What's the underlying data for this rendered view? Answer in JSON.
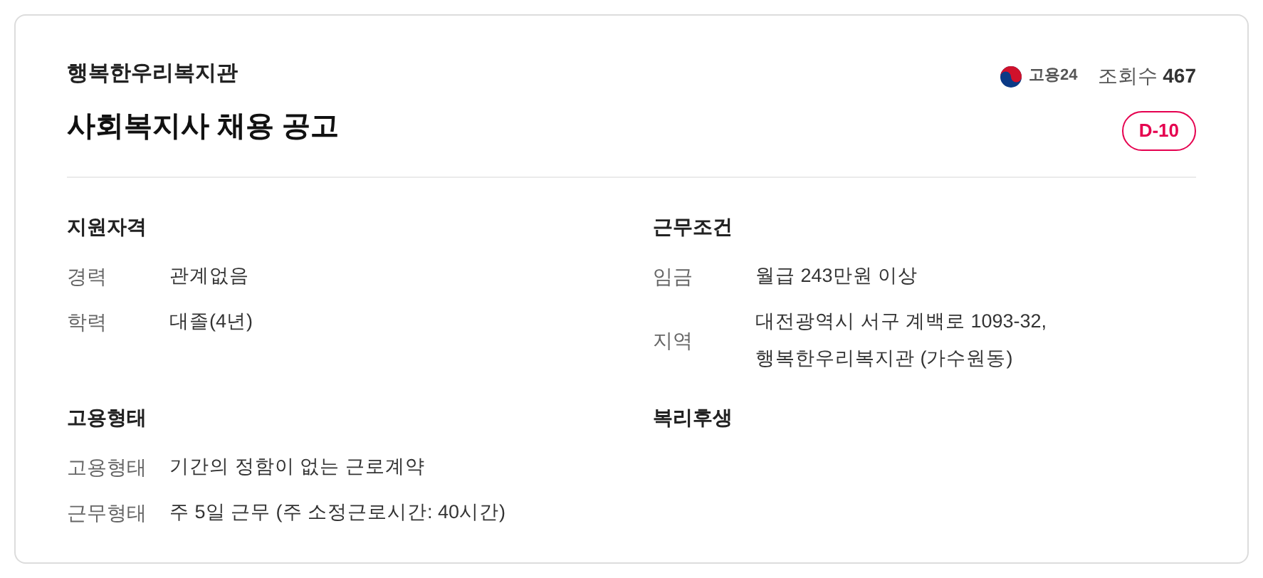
{
  "header": {
    "organization": "행복한우리복지관",
    "title": "사회복지사 채용 공고",
    "source": "고용24",
    "views_label": "조회수",
    "views": "467",
    "deadline_badge": "D-10"
  },
  "sections": [
    {
      "title": "지원자격",
      "rows": [
        {
          "label": "경력",
          "value": "관계없음"
        },
        {
          "label": "학력",
          "value": "대졸(4년)"
        }
      ]
    },
    {
      "title": "근무조건",
      "rows": [
        {
          "label": "임금",
          "value": "월급 243만원 이상"
        },
        {
          "label": "지역",
          "value": "대전광역시 서구 계백로 1093-32, 행복한우리복지관 (가수원동)"
        }
      ]
    },
    {
      "title": "고용형태",
      "rows": [
        {
          "label": "고용형태",
          "value": "기간의 정함이 없는 근로계약"
        },
        {
          "label": "근무형태",
          "value": "주 5일 근무 (주 소정근로시간: 40시간)"
        }
      ]
    },
    {
      "title": "복리후생"
    }
  ]
}
